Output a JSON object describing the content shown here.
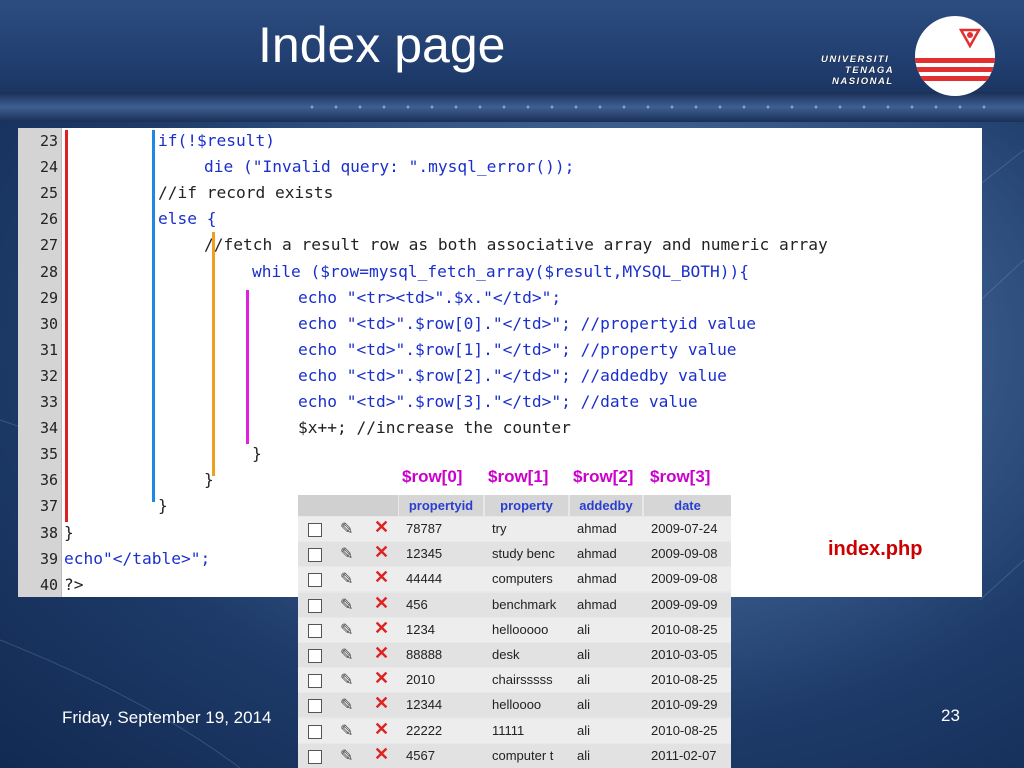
{
  "slide": {
    "title": "Index page",
    "footer_date": "Friday, September 19, 2014",
    "page_number": "23",
    "file_label": "index.php"
  },
  "logo": {
    "line1": "UNIVERSITI",
    "line2": "TENAGA",
    "line3": "NASIONAL"
  },
  "code": {
    "lines": [
      {
        "n": "23",
        "text": "if(!$result)"
      },
      {
        "n": "24",
        "text": "die (\"Invalid query: \".mysql_error());"
      },
      {
        "n": "25",
        "text": "//if record exists"
      },
      {
        "n": "26",
        "text": "else {"
      },
      {
        "n": "27",
        "text": "//fetch a result row as both associative array and numeric array"
      },
      {
        "n": "28",
        "text": "while ($row=mysql_fetch_array($result,MYSQL_BOTH)){"
      },
      {
        "n": "29",
        "text": "echo \"<tr><td>\".$x.\"</td>\";"
      },
      {
        "n": "30",
        "text": "echo \"<td>\".$row[0].\"</td>\"; //propertyid value"
      },
      {
        "n": "31",
        "text": "echo \"<td>\".$row[1].\"</td>\"; //property value"
      },
      {
        "n": "32",
        "text": "echo \"<td>\".$row[2].\"</td>\"; //addedby value"
      },
      {
        "n": "33",
        "text": "echo \"<td>\".$row[3].\"</td>\"; //date value"
      },
      {
        "n": "34",
        "text": "$x++; //increase the counter"
      },
      {
        "n": "35",
        "text": "}"
      },
      {
        "n": "36",
        "text": "}"
      },
      {
        "n": "37",
        "text": "}"
      },
      {
        "n": "38",
        "text": "}"
      },
      {
        "n": "39",
        "text": "echo\"</table>\";"
      },
      {
        "n": "40",
        "text": "?>"
      }
    ]
  },
  "row_labels": [
    "$row[0]",
    "$row[1]",
    "$row[2]",
    "$row[3]"
  ],
  "table": {
    "columns": [
      "propertyid",
      "property",
      "addedby",
      "date"
    ],
    "rows": [
      [
        "78787",
        "try",
        "ahmad",
        "2009-07-24"
      ],
      [
        "12345",
        "study benc",
        "ahmad",
        "2009-09-08"
      ],
      [
        "44444",
        "computers",
        "ahmad",
        "2009-09-08"
      ],
      [
        "456",
        "benchmark",
        "ahmad",
        "2009-09-09"
      ],
      [
        "1234",
        "hellooooo",
        "ali",
        "2010-08-25"
      ],
      [
        "88888",
        "desk",
        "ali",
        "2010-03-05"
      ],
      [
        "2010",
        "chairsssss",
        "ali",
        "2010-08-25"
      ],
      [
        "12344",
        "helloooo",
        "ali",
        "2010-09-29"
      ],
      [
        "22222",
        "11111",
        "ali",
        "2010-08-25"
      ],
      [
        "4567",
        "computer t",
        "ali",
        "2011-02-07"
      ]
    ]
  },
  "colors": {
    "keyword": "#1a2fcc",
    "function": "#c01818",
    "label_magenta": "#cc00cc",
    "filename_red": "#cc0000",
    "bar_red": "#e02020",
    "bar_blue": "#1e88e5",
    "bar_orange": "#f0a020",
    "bar_magenta": "#e020e0"
  }
}
